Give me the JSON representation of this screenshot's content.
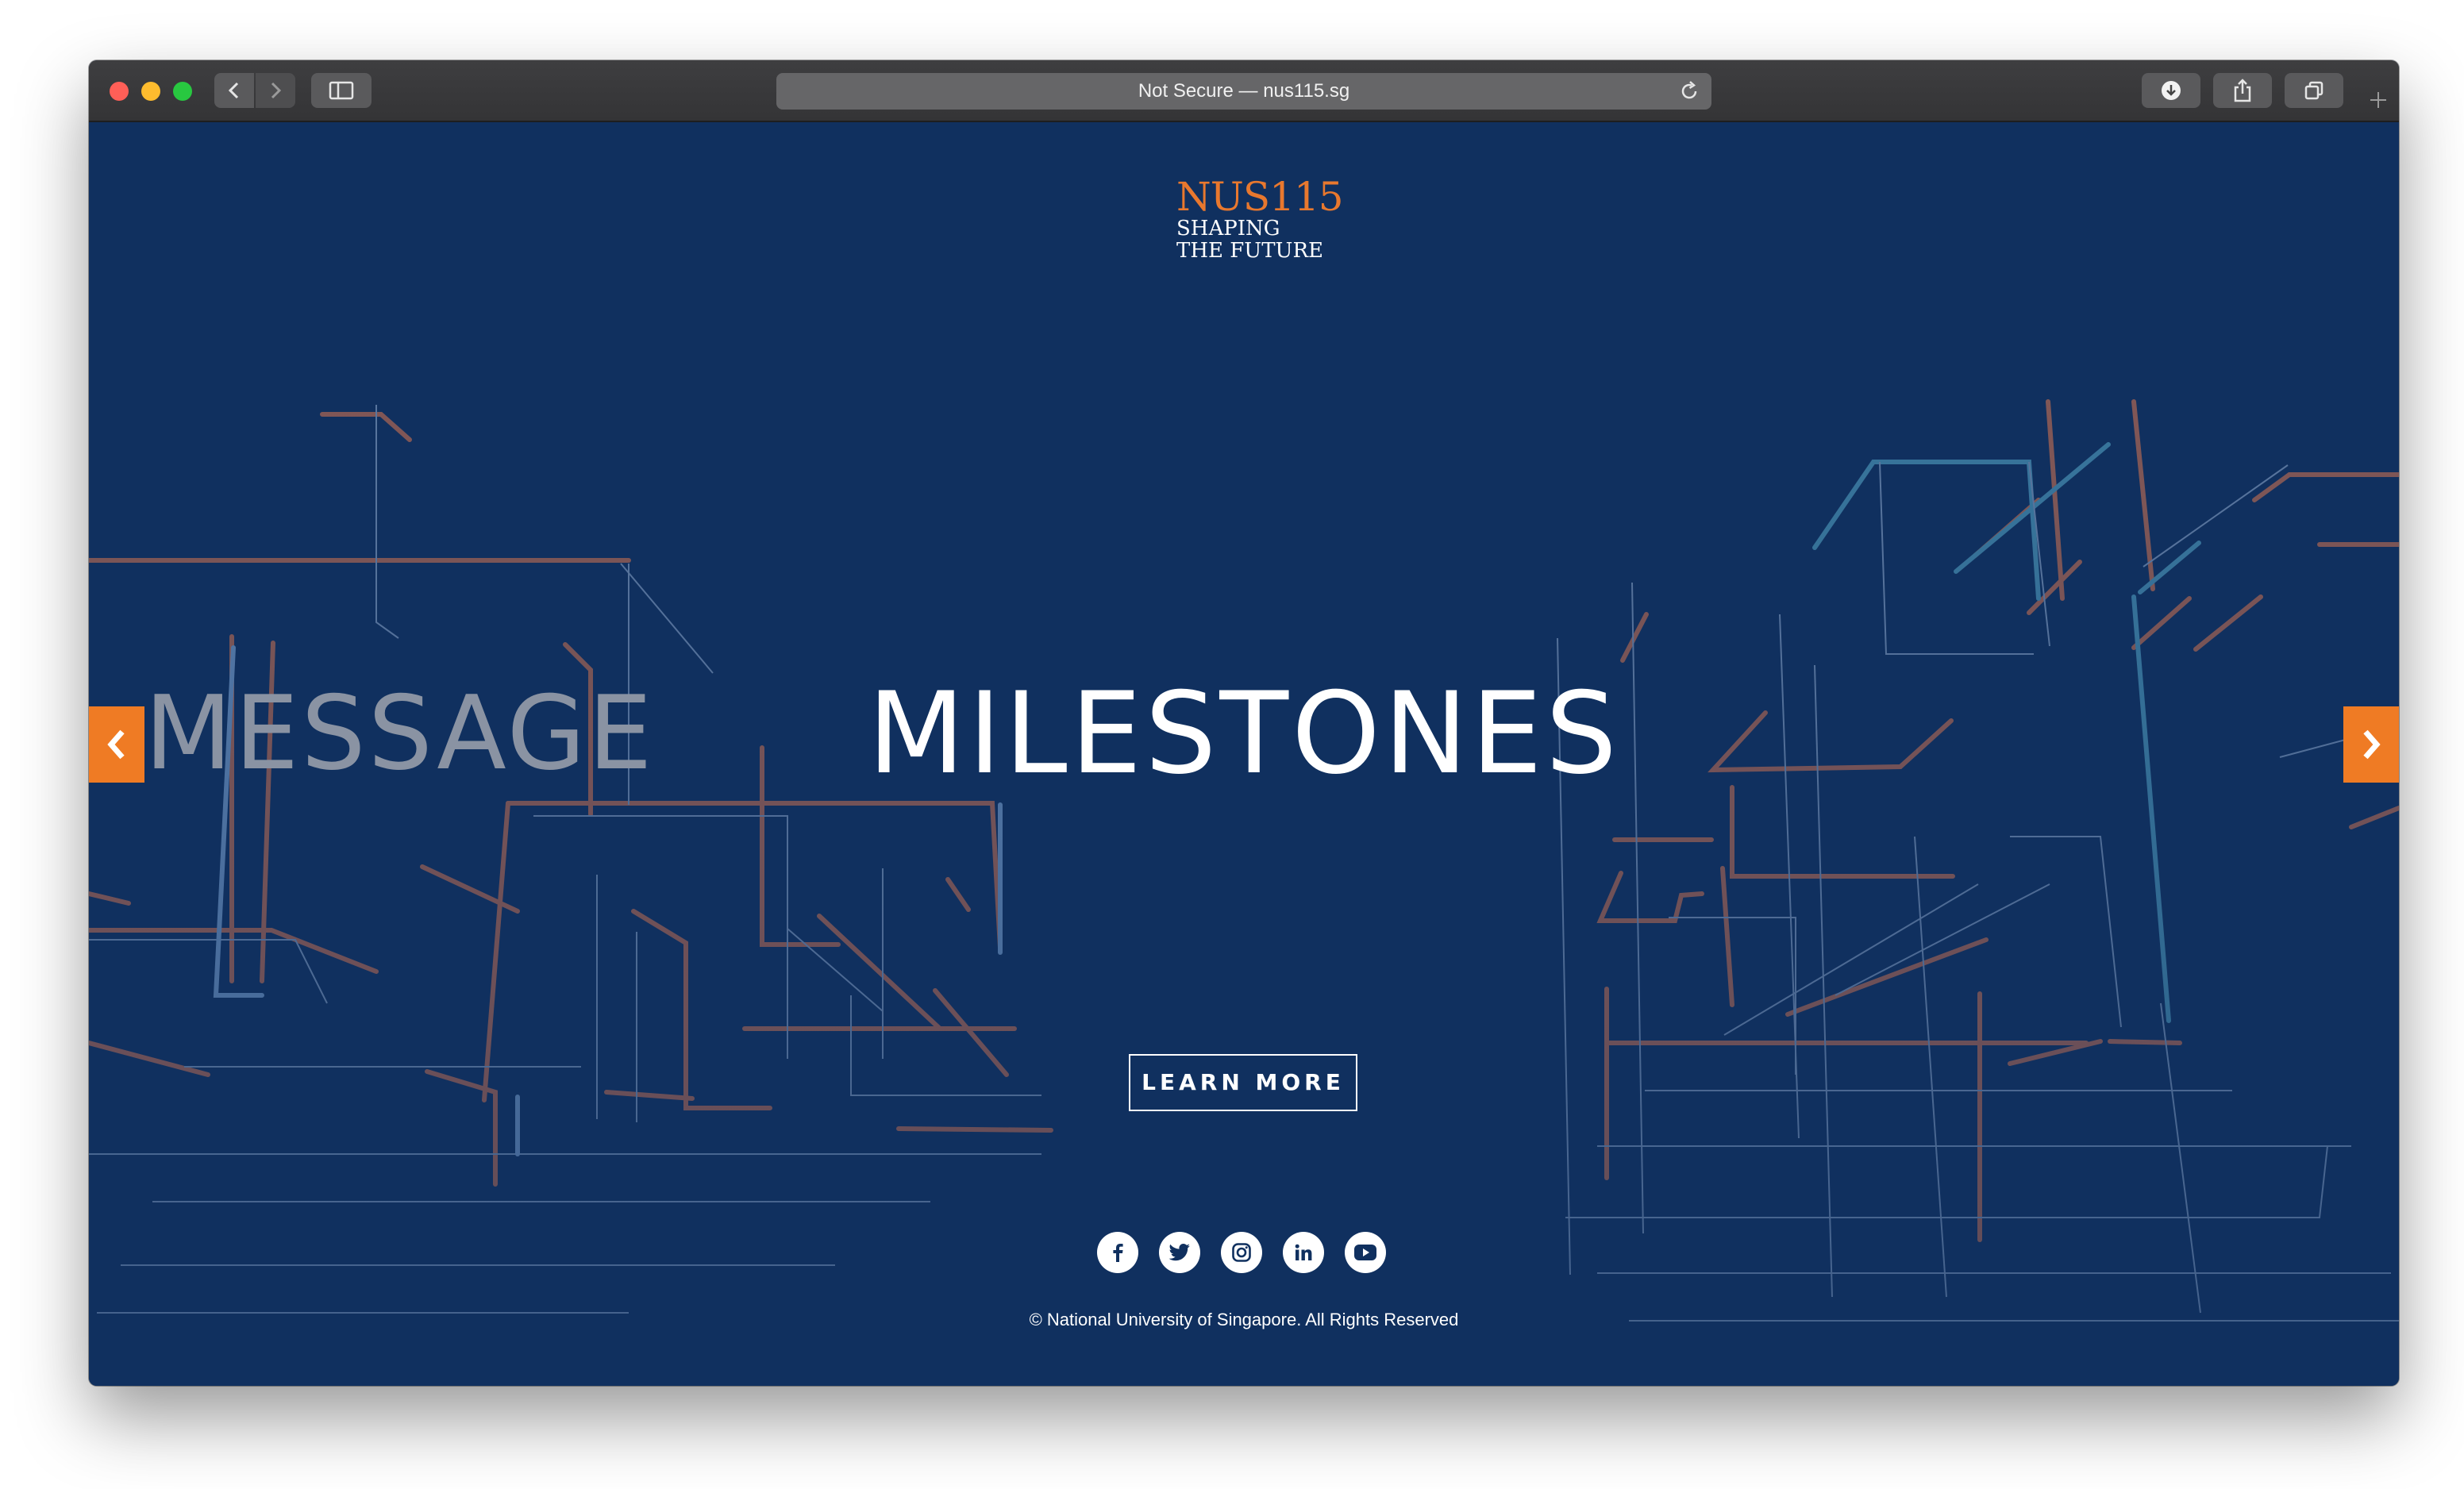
{
  "browser": {
    "address_text": "Not Secure — nus115.sg"
  },
  "brand": {
    "logo_primary": "NUS115",
    "logo_line1": "SHAPING",
    "logo_line2": "THE FUTURE",
    "accent_color": "#ef7b24",
    "background_color": "#10305f"
  },
  "hero": {
    "prev_slide_title": "MESSAGE",
    "current_slide_title": "MILESTONES",
    "cta_label": "LEARN MORE"
  },
  "carousel": {
    "prev_icon": "chevron-left-icon",
    "next_icon": "chevron-right-icon"
  },
  "footer": {
    "socials": [
      "facebook-icon",
      "twitter-icon",
      "instagram-icon",
      "linkedin-icon",
      "youtube-icon"
    ],
    "copyright": "© National University of Singapore. All Rights Reserved"
  }
}
